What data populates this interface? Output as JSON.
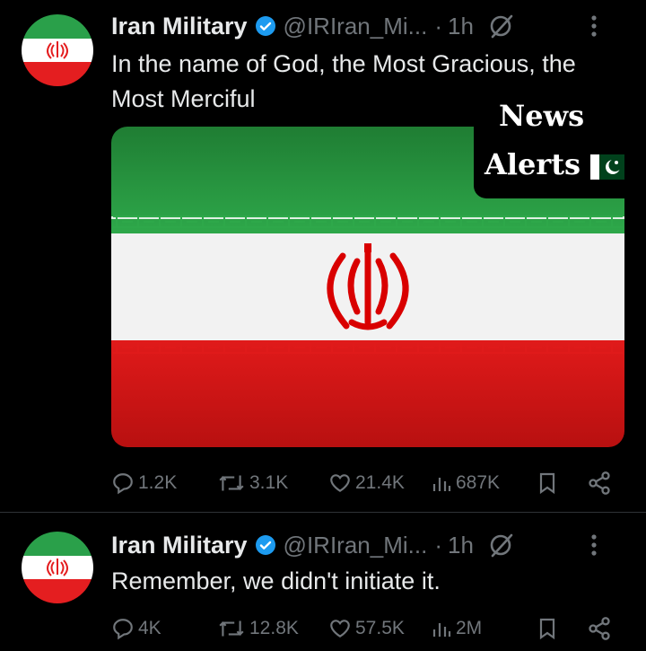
{
  "tweets": [
    {
      "author_name": "Iran Military",
      "handle": "@IRIran_Mi...",
      "separator": "·",
      "time": "1h",
      "text": "In the name of God, the Most Gracious, the Most Merciful",
      "media": {
        "description_icon": "iran-flag-image",
        "watermark_line1": "News",
        "watermark_line2": "Alerts"
      },
      "stats": {
        "replies": "1.2K",
        "reposts": "3.1K",
        "likes": "21.4K",
        "views": "687K"
      }
    },
    {
      "author_name": "Iran Military",
      "handle": "@IRIran_Mi...",
      "separator": "·",
      "time": "1h",
      "text": "Remember, we didn't initiate it.",
      "stats": {
        "replies": "4K",
        "reposts": "12.8K",
        "likes": "57.5K",
        "views": "2M"
      }
    }
  ],
  "colors": {
    "background": "#000000",
    "text_primary": "#e7e9ea",
    "text_secondary": "#71767b",
    "verified_blue": "#1d9bf0",
    "flag_green": "#239f40",
    "flag_white": "#ffffff",
    "flag_red": "#da0000"
  }
}
